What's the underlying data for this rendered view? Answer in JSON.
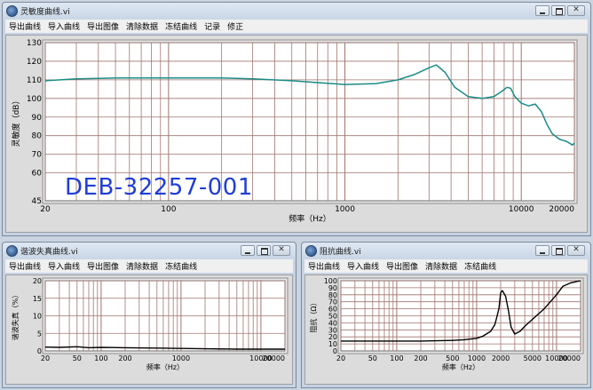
{
  "main": {
    "title": "灵敏度曲线.vi",
    "menu": [
      "导出曲线",
      "导入曲线",
      "导出图像",
      "清除数据",
      "冻结曲线",
      "记录",
      "修正"
    ],
    "overlay_text": "DEB-32257-001"
  },
  "thd": {
    "title": "谐波失真曲线.vi",
    "menu": [
      "导出曲线",
      "导入曲线",
      "导出图像",
      "清除数据",
      "冻结曲线"
    ]
  },
  "imp": {
    "title": "阻抗曲线.vi",
    "menu": [
      "导出曲线",
      "导入曲线",
      "导出图像",
      "清除数据",
      "冻结曲线"
    ]
  },
  "colors": {
    "desktop": "#c9d4e0",
    "plot_bg": "#ffffff",
    "grid": "#a0756e",
    "main_trace": "#1a8b86",
    "trace": "#000000",
    "overlay": "#1f3dd8"
  },
  "chart_data": [
    {
      "type": "line",
      "xscale": "log",
      "xlabel": "频率（Hz）",
      "ylabel": "灵敏度（dB）",
      "xlim": [
        20,
        20000
      ],
      "ylim": [
        45,
        130
      ],
      "xtick_labels": [
        "20",
        "100",
        "1000",
        "10000",
        "20000"
      ],
      "ytick_labels": [
        "45",
        "60",
        "70",
        "80",
        "90",
        "100",
        "110",
        "120",
        "130"
      ],
      "series": [
        {
          "x": [
            20,
            30,
            50,
            100,
            200,
            300,
            500,
            700,
            1000,
            1500,
            2000,
            2500,
            3000,
            3300,
            3700,
            4200,
            5000,
            6000,
            7000,
            7800,
            8300,
            8700,
            9200,
            10000,
            11000,
            12000,
            13000,
            14000,
            15000,
            16500,
            18000,
            19500,
            20000
          ],
          "y": [
            109.5,
            110.5,
            111,
            111,
            111,
            110.5,
            109.5,
            108.5,
            107.5,
            108,
            110,
            113,
            116.5,
            118,
            114,
            106,
            101,
            100,
            101,
            104,
            106,
            105.5,
            101,
            97.5,
            96,
            97,
            93,
            86,
            81,
            78,
            77,
            75,
            76
          ]
        }
      ]
    },
    {
      "type": "line",
      "xscale": "log",
      "xlabel": "频率（Hz）",
      "ylabel": "谐波失真（%）",
      "xlim": [
        20,
        20000
      ],
      "ylim": [
        0,
        20
      ],
      "xtick_labels": [
        "20",
        "50",
        "100",
        "200",
        "1000",
        "10000",
        "20000"
      ],
      "ytick_labels": [
        "0",
        "5",
        "10",
        "15",
        "20"
      ],
      "series": [
        {
          "x": [
            20,
            30,
            50,
            70,
            100,
            200,
            500,
            1000,
            2000,
            5000,
            10000,
            20000
          ],
          "y": [
            1.1,
            1.0,
            1.2,
            0.9,
            1.0,
            0.9,
            0.8,
            0.7,
            0.6,
            0.5,
            0.5,
            0.5
          ]
        }
      ]
    },
    {
      "type": "line",
      "xscale": "log",
      "xlabel": "频率（Hz）",
      "ylabel": "阻抗（Ω）",
      "xlim": [
        20,
        20000
      ],
      "ylim": [
        0,
        100
      ],
      "xtick_labels": [
        "20",
        "50",
        "100",
        "200",
        "500",
        "1000",
        "2000",
        "5000",
        "10000",
        "20000"
      ],
      "ytick_labels": [
        "0",
        "10",
        "20",
        "30",
        "40",
        "50",
        "60",
        "70",
        "80",
        "90",
        "100"
      ],
      "series": [
        {
          "x": [
            20,
            50,
            100,
            200,
            500,
            700,
            1000,
            1200,
            1500,
            1700,
            1900,
            2000,
            2100,
            2300,
            2500,
            2700,
            3000,
            3500,
            4000,
            5000,
            7000,
            10000,
            12000,
            15000,
            20000
          ],
          "y": [
            14,
            14,
            14,
            14,
            15,
            16,
            18,
            21,
            28,
            38,
            60,
            83,
            86,
            78,
            58,
            34,
            24,
            28,
            35,
            45,
            60,
            80,
            92,
            97,
            100
          ]
        }
      ]
    }
  ]
}
